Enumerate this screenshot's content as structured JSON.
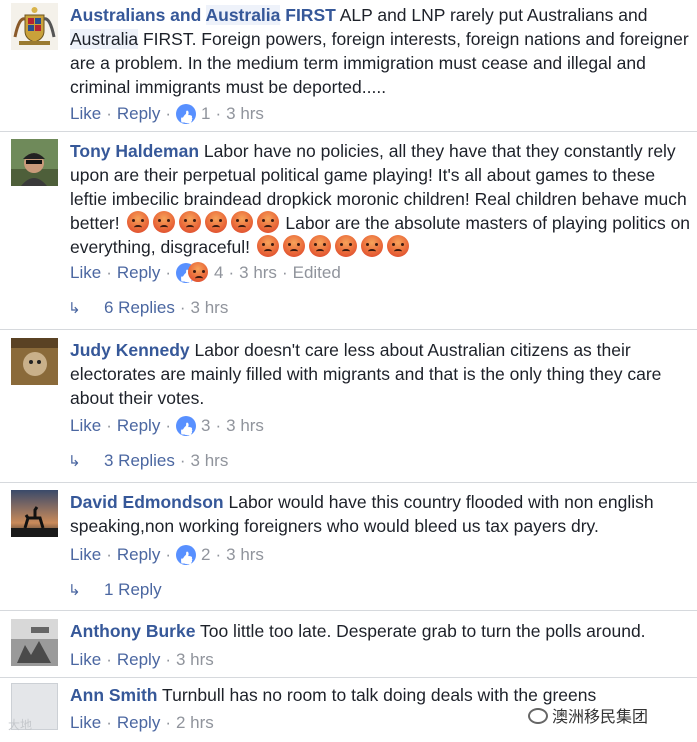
{
  "comments": [
    {
      "name_parts": [
        "Australians and ",
        "Australia",
        " FIRST"
      ],
      "text_parts": [
        " ALP and LNP rarely put Australians and ",
        "Australia",
        " FIRST. Foreign powers, foreign interests, foreign nations and foreigner are a problem. In the medium term immigration must cease and illegal and criminal immigrants must be deported....."
      ],
      "like": "Like",
      "reply": "Reply",
      "count": "1",
      "time": "3 hrs"
    },
    {
      "name": "Tony Haldeman",
      "text_a": " Labor have no policies, all they have that they constantly rely upon are their perpetual political game playing! It's all about games to these leftie imbecilic braindead dropkick moronic children! Real children behave much better!",
      "text_b": " Labor are the absolute masters of playing politics on everything, disgraceful!",
      "like": "Like",
      "reply": "Reply",
      "count": "4",
      "time": "3 hrs",
      "edited": "Edited",
      "replies": "6 Replies",
      "replies_time": "3 hrs"
    },
    {
      "name": "Judy Kennedy",
      "text": " Labor doesn't care less about Australian citizens as their electorates are mainly filled with migrants and that is the only thing they care about their votes.",
      "like": "Like",
      "reply": "Reply",
      "count": "3",
      "time": "3 hrs",
      "replies": "3 Replies",
      "replies_time": "3 hrs"
    },
    {
      "name": "David Edmondson",
      "text": " Labor would have this country flooded with non english speaking,non working foreigners who would bleed us tax payers dry.",
      "like": "Like",
      "reply": "Reply",
      "count": "2",
      "time": "3 hrs",
      "replies": "1 Reply"
    },
    {
      "name": "Anthony Burke",
      "text": " Too little too late. Desperate grab to turn the polls around.",
      "like": "Like",
      "reply": "Reply",
      "time": "3 hrs"
    },
    {
      "name": "Ann Smith",
      "text": " Turnbull has no room to talk doing deals with the greens",
      "like": "Like",
      "reply": "Reply",
      "time": "2 hrs"
    }
  ],
  "sep": "·",
  "watermark": "大地",
  "wechat_label": "澳洲移民集团",
  "colors": {
    "name": "#365899",
    "meta": "#90949c",
    "link": "#4b67a1",
    "like_blue": "#5890ff"
  }
}
